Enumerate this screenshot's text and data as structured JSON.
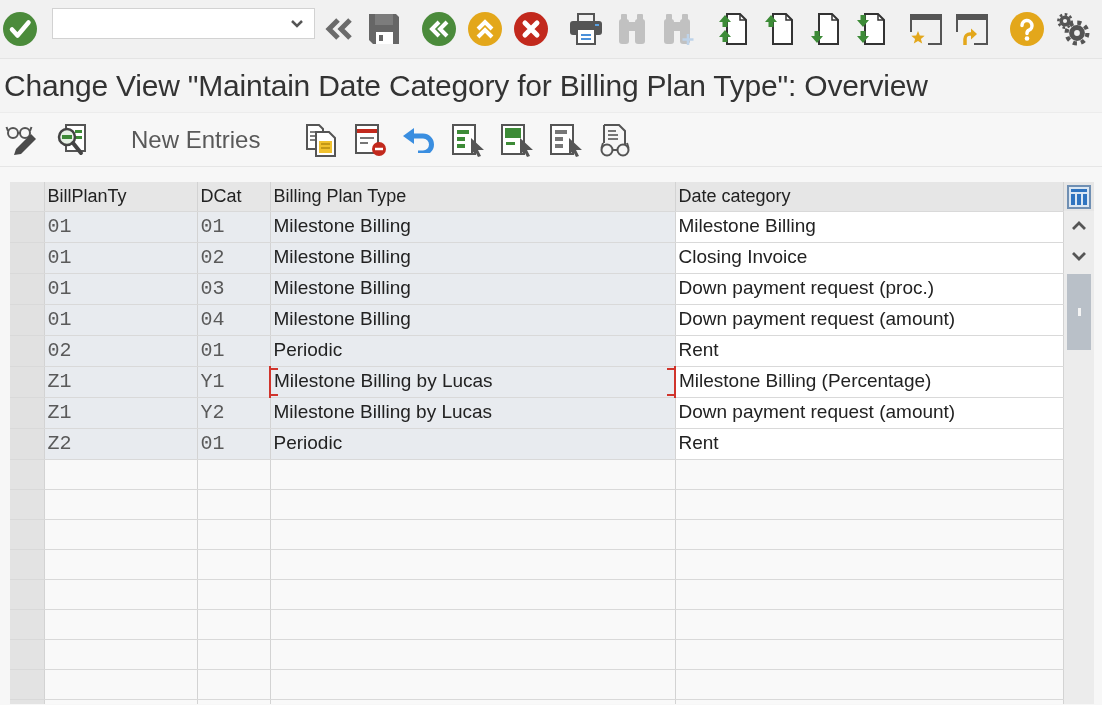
{
  "system_toolbar": {
    "items": [
      {
        "kind": "enter",
        "disabled": false
      },
      {
        "kind": "command_field",
        "disabled": false
      },
      {
        "kind": "collapse",
        "disabled": false
      },
      {
        "kind": "save",
        "disabled": false
      },
      {
        "kind": "back",
        "disabled": false
      },
      {
        "kind": "exit",
        "disabled": false
      },
      {
        "kind": "cancel",
        "disabled": false
      },
      {
        "kind": "print",
        "disabled": false
      },
      {
        "kind": "find",
        "disabled": true
      },
      {
        "kind": "find_next",
        "disabled": true
      },
      {
        "kind": "first_page",
        "disabled": false
      },
      {
        "kind": "previous_page",
        "disabled": false
      },
      {
        "kind": "next_page",
        "disabled": false
      },
      {
        "kind": "last_page",
        "disabled": false
      },
      {
        "kind": "new_session",
        "disabled": false
      },
      {
        "kind": "shortcut",
        "disabled": false
      },
      {
        "kind": "help",
        "disabled": false
      },
      {
        "kind": "settings",
        "disabled": false
      }
    ]
  },
  "title": "Change View \"Maintain Date Category for Billing Plan Type\": Overview",
  "application_toolbar": {
    "items": [
      {
        "kind": "display_change"
      },
      {
        "kind": "find"
      },
      {
        "kind": "new_entries",
        "label": "New Entries"
      },
      {
        "kind": "copy"
      },
      {
        "kind": "delete"
      },
      {
        "kind": "undo"
      },
      {
        "kind": "select_all"
      },
      {
        "kind": "select_block"
      },
      {
        "kind": "deselect_all"
      },
      {
        "kind": "details"
      }
    ]
  },
  "table": {
    "columns": [
      "BillPlanTy",
      "DCat",
      "Billing Plan Type",
      "Date category"
    ],
    "rows": [
      {
        "cells": [
          "01",
          "01",
          "Milestone Billing",
          "Milestone Billing"
        ],
        "focused": false
      },
      {
        "cells": [
          "01",
          "02",
          "Milestone Billing",
          "Closing Invoice"
        ],
        "focused": false
      },
      {
        "cells": [
          "01",
          "03",
          "Milestone Billing",
          "Down payment request (proc.)"
        ],
        "focused": false
      },
      {
        "cells": [
          "01",
          "04",
          "Milestone Billing",
          "Down payment request (amount)"
        ],
        "focused": false
      },
      {
        "cells": [
          "02",
          "01",
          "Periodic",
          "Rent"
        ],
        "focused": false
      },
      {
        "cells": [
          "Z1",
          "Y1",
          "Milestone Billing by Lucas",
          "Milestone Billing (Percentage)"
        ],
        "focused": true
      },
      {
        "cells": [
          "Z1",
          "Y2",
          "Milestone Billing by Lucas",
          "Down payment request (amount)"
        ],
        "focused": false
      },
      {
        "cells": [
          "Z2",
          "01",
          "Periodic",
          "Rent"
        ],
        "focused": false
      }
    ]
  }
}
